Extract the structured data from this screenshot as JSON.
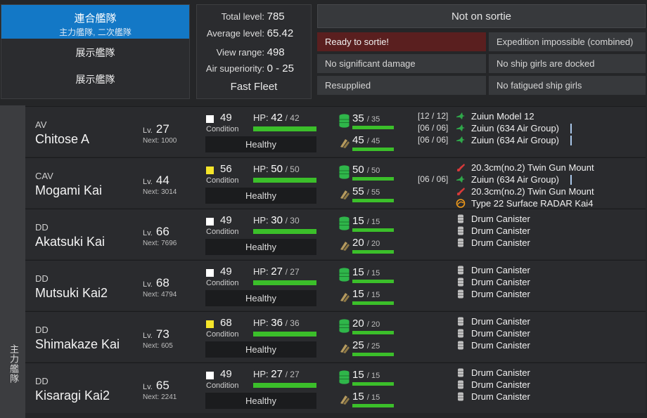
{
  "fleet_nav": {
    "combined_label": "連合艦隊",
    "combined_sub": "主力艦隊, 二次艦隊",
    "fleet_1": "展示艦隊",
    "fleet_2": "展示艦隊"
  },
  "summary": {
    "total_level_label": "Total level:",
    "total_level": "785",
    "average_level_label": "Average level:",
    "average_level": "65.42",
    "view_range_label": "View range:",
    "view_range": "498",
    "air_superiority_label": "Air superiority:",
    "air_superiority": "0 - 25",
    "speed": "Fast Fleet"
  },
  "status": {
    "sortie": "Not on sortie",
    "badges": [
      "Ready to sortie!",
      "Expedition impossible (combined)",
      "No significant damage",
      "No ship girls are docked",
      "Resupplied",
      "No fatigued ship girls"
    ]
  },
  "fleet_label": "主力艦隊",
  "labels": {
    "lv": "Lv.",
    "next": "Next:",
    "condition": "Condition",
    "hp": "HP:"
  },
  "ships": [
    {
      "type": "AV",
      "name": "Chitose A",
      "level": "27",
      "next": "1000",
      "cond": "49",
      "cond_color": "#ffffff",
      "hp": "42",
      "hp_max": "/ 42",
      "hp_fraction": 1,
      "health": "Healthy",
      "fuel": "35",
      "fuel_max": "/ 35",
      "ammo": "45",
      "ammo_max": "/ 45",
      "slots": [
        {
          "icon": "seaplane-icon",
          "name": "Zuiun Model 12",
          "count": "[12 / 12]",
          "prof": false
        },
        {
          "icon": "seaplane-icon",
          "name": "Zuiun (634 Air Group)",
          "count": "[06 / 06]",
          "prof": true
        },
        {
          "icon": "seaplane-icon",
          "name": "Zuiun (634 Air Group)",
          "count": "[06 / 06]",
          "prof": true
        }
      ]
    },
    {
      "type": "CAV",
      "name": "Mogami Kai",
      "level": "44",
      "next": "3014",
      "cond": "56",
      "cond_color": "#f5e52a",
      "hp": "50",
      "hp_max": "/ 50",
      "hp_fraction": 1,
      "health": "Healthy",
      "fuel": "50",
      "fuel_max": "/ 50",
      "ammo": "55",
      "ammo_max": "/ 55",
      "slots": [
        {
          "icon": "gun-mount-icon",
          "name": "20.3cm(no.2) Twin Gun Mount",
          "count": "",
          "prof": false
        },
        {
          "icon": "seaplane-icon",
          "name": "Zuiun (634 Air Group)",
          "count": "[06 / 06]",
          "prof": true
        },
        {
          "icon": "gun-mount-icon",
          "name": "20.3cm(no.2) Twin Gun Mount",
          "count": "",
          "prof": false
        },
        {
          "icon": "radar-icon",
          "name": "Type 22 Surface RADAR Kai4",
          "count": "",
          "prof": false
        }
      ]
    },
    {
      "type": "DD",
      "name": "Akatsuki Kai",
      "level": "66",
      "next": "7696",
      "cond": "49",
      "cond_color": "#ffffff",
      "hp": "30",
      "hp_max": "/ 30",
      "hp_fraction": 1,
      "health": "Healthy",
      "fuel": "15",
      "fuel_max": "/ 15",
      "ammo": "20",
      "ammo_max": "/ 20",
      "slots": [
        {
          "icon": "drum-icon",
          "name": "Drum Canister",
          "count": "",
          "prof": false
        },
        {
          "icon": "drum-icon",
          "name": "Drum Canister",
          "count": "",
          "prof": false
        },
        {
          "icon": "drum-icon",
          "name": "Drum Canister",
          "count": "",
          "prof": false
        }
      ]
    },
    {
      "type": "DD",
      "name": "Mutsuki Kai2",
      "level": "68",
      "next": "4794",
      "cond": "49",
      "cond_color": "#ffffff",
      "hp": "27",
      "hp_max": "/ 27",
      "hp_fraction": 1,
      "health": "Healthy",
      "fuel": "15",
      "fuel_max": "/ 15",
      "ammo": "15",
      "ammo_max": "/ 15",
      "slots": [
        {
          "icon": "drum-icon",
          "name": "Drum Canister",
          "count": "",
          "prof": false
        },
        {
          "icon": "drum-icon",
          "name": "Drum Canister",
          "count": "",
          "prof": false
        },
        {
          "icon": "drum-icon",
          "name": "Drum Canister",
          "count": "",
          "prof": false
        }
      ]
    },
    {
      "type": "DD",
      "name": "Shimakaze Kai",
      "level": "73",
      "next": "605",
      "cond": "68",
      "cond_color": "#f5e52a",
      "hp": "36",
      "hp_max": "/ 36",
      "hp_fraction": 1,
      "health": "Healthy",
      "fuel": "20",
      "fuel_max": "/ 20",
      "ammo": "25",
      "ammo_max": "/ 25",
      "slots": [
        {
          "icon": "drum-icon",
          "name": "Drum Canister",
          "count": "",
          "prof": false
        },
        {
          "icon": "drum-icon",
          "name": "Drum Canister",
          "count": "",
          "prof": false
        },
        {
          "icon": "drum-icon",
          "name": "Drum Canister",
          "count": "",
          "prof": false
        }
      ]
    },
    {
      "type": "DD",
      "name": "Kisaragi Kai2",
      "level": "65",
      "next": "2241",
      "cond": "49",
      "cond_color": "#ffffff",
      "hp": "27",
      "hp_max": "/ 27",
      "hp_fraction": 1,
      "health": "Healthy",
      "fuel": "15",
      "fuel_max": "/ 15",
      "ammo": "15",
      "ammo_max": "/ 15",
      "slots": [
        {
          "icon": "drum-icon",
          "name": "Drum Canister",
          "count": "",
          "prof": false
        },
        {
          "icon": "drum-icon",
          "name": "Drum Canister",
          "count": "",
          "prof": false
        },
        {
          "icon": "drum-icon",
          "name": "Drum Canister",
          "count": "",
          "prof": false
        }
      ]
    }
  ]
}
